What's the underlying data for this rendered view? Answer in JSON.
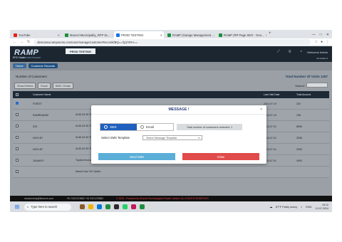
{
  "browser": {
    "tabs": [
      {
        "label": "YouTube",
        "color": "#e62117"
      },
      {
        "label": "Muncel Municipality_RFP Sc...",
        "color": "#1e8e3e"
      },
      {
        "label": "PROD TESTING",
        "color": "#1a73e8",
        "active": true
      },
      {
        "label": "RAMP (Garage Management ...",
        "color": "#1e8e3e"
      },
      {
        "label": "RAMP (RP Page SEO - Goo...",
        "color": "#1e8e3e"
      }
    ],
    "url": "demonew.rampoems.com/user/manageCustomerRecords/BQ==/Q1/VRA==",
    "window_controls": [
      "—",
      "□",
      "✕"
    ]
  },
  "app": {
    "logo": "RAMP",
    "logo_sub": "THE AUTOMOTIVE ERP",
    "env_badge": "PROD TESTING",
    "brd_code": "BRD Code:",
    "welcome": "Welcome Admin",
    "site_select": "demoface ▾",
    "breadcrumb": {
      "home": "Home",
      "current": "Customer Records"
    },
    "section_title": "Number of Customers",
    "visits_title": "Total Number Of Visits 1257",
    "actions": [
      "Show Entries",
      "Excel",
      "SMS / Email"
    ],
    "search_label": "Search:",
    "table": {
      "headers": [
        "",
        "Customer Name",
        "",
        "",
        "",
        "",
        "Last Visit Date",
        "Total Amount"
      ],
      "rows": [
        {
          "checked": true,
          "name": "FORZIT",
          "vehicle": "",
          "phone": "",
          "col4": "",
          "col5": "",
          "date": "2024-07-19",
          "amount": "320"
        },
        {
          "checked": false,
          "name": "RAMRINANDI",
          "vehicle": "AUDI A3 35 TDI Attraction (Diesel)",
          "phone": "7204924809",
          "col4": "8079392634",
          "col5": "1",
          "date": "2024-07-10",
          "amount": "238"
        },
        {
          "checked": false,
          "name": "Z34",
          "vehicle": "AUDI A3 35 TDI Attraction (Diesel)",
          "phone": "7204924840",
          "col4": "7709722662",
          "col5": "1",
          "date": "2024-07-01",
          "amount": "8596"
        },
        {
          "checked": false,
          "name": "HIGH-B7",
          "vehicle": "AUDI A3 35 TDI Premium Plus (Diesel)",
          "phone": "7327683",
          "col4": "8976544494",
          "col5": "1",
          "date": "2024-07-01",
          "amount": "3336"
        },
        {
          "checked": false,
          "name": "HIGH-B7",
          "vehicle": "AUDI A3 35 TDI Attraction (Diesel)",
          "phone": "7327683",
          "col4": "8976544494",
          "col5": "1",
          "date": "2024-07-01",
          "amount": "2933"
        },
        {
          "checked": false,
          "name": "JUNAKEY",
          "vehicle": "Toyota Innova Crysta 2.4 VX (Diesel)",
          "phone": "732794474",
          "col4": "8465302797",
          "col5": "1",
          "date": "2024-07-01",
          "amount": "4900"
        },
        {
          "checked": false,
          "name": "",
          "vehicle": "Maruti Ciaz VXi Option",
          "phone": "",
          "col4": "",
          "col5": "",
          "date": "",
          "amount": ""
        }
      ]
    },
    "footer": {
      "email": "ramsionhelp@lihamoh.com",
      "phones": "+91 9321223882  +91 9321223882",
      "copyright": "© 2024 - Powered by Shamrit Technologies Private Limited. ALL RIGHTS RESERVED"
    }
  },
  "modal": {
    "title": "MESSAGE !",
    "close_icon": "×",
    "options": [
      "SMS",
      "Email"
    ],
    "selected_option": "SMS",
    "selected_info": "Total number of customers selected: 1",
    "template_label": "Select SMS Template",
    "template_placeholder": "Select Message Template",
    "send_label": "Send SMS",
    "close_label": "Close",
    "colors": {
      "send": "#5aaed8",
      "close": "#e14b4b",
      "selected": "#1f5fbf"
    }
  },
  "taskbar": {
    "search_placeholder": "Type here to search",
    "weather": "87°F  Partly sunny",
    "lang": "ENG",
    "time": "19:12",
    "date": "12-07-2024",
    "app_colors": [
      "#8a5a2b",
      "#f0b400",
      "#0078d4",
      "#1e8e3e",
      "#2b2b2b",
      "#25d366",
      "#c2185b",
      "#1e8e3e"
    ]
  }
}
